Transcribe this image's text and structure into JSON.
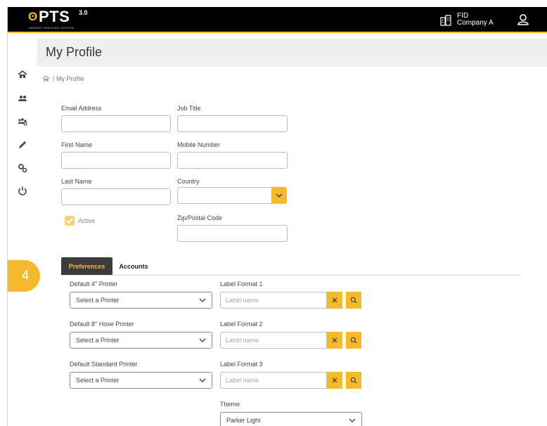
{
  "header": {
    "logo_text": "PTS",
    "logo_version": "3.0",
    "logo_subtitle": "PARKER TRACKING SYSTEM",
    "tenant_code": "FID",
    "tenant_name": "Company A"
  },
  "sidebar": {
    "items": [
      {
        "icon": "home-icon"
      },
      {
        "icon": "users-icon"
      },
      {
        "icon": "user-group-icon"
      },
      {
        "icon": "pencil-icon"
      },
      {
        "icon": "gears-icon"
      },
      {
        "icon": "power-icon"
      }
    ]
  },
  "page": {
    "title": "My Profile",
    "breadcrumb": "/ My Profile"
  },
  "form": {
    "email_label": "Email Address",
    "job_title_label": "Job Title",
    "first_name_label": "First Name",
    "mobile_label": "Mobile Number",
    "last_name_label": "Last Name",
    "country_label": "Country",
    "active_label": "Active",
    "active_checked": true,
    "zip_label": "Zip/Postal Code"
  },
  "tabs": {
    "preferences": "Preferences",
    "accounts": "Accounts",
    "active": "Preferences"
  },
  "step_badge": "4",
  "preferences": {
    "printer4_label": "Default 4\" Printer",
    "printer8_label": "Default 8\" Hose Printer",
    "printer_std_label": "Default Standard Printer",
    "printer_placeholder": "Select a Printer",
    "label1_label": "Label Format 1",
    "label2_label": "Label Format 2",
    "label3_label": "Label Format 3",
    "label_placeholder": "Label name",
    "theme_label": "Theme",
    "theme_value": "Parker Light"
  },
  "colors": {
    "accent": "#f6b92b",
    "header_bg": "#000000",
    "tab_active_bg": "#3c3c3c"
  }
}
